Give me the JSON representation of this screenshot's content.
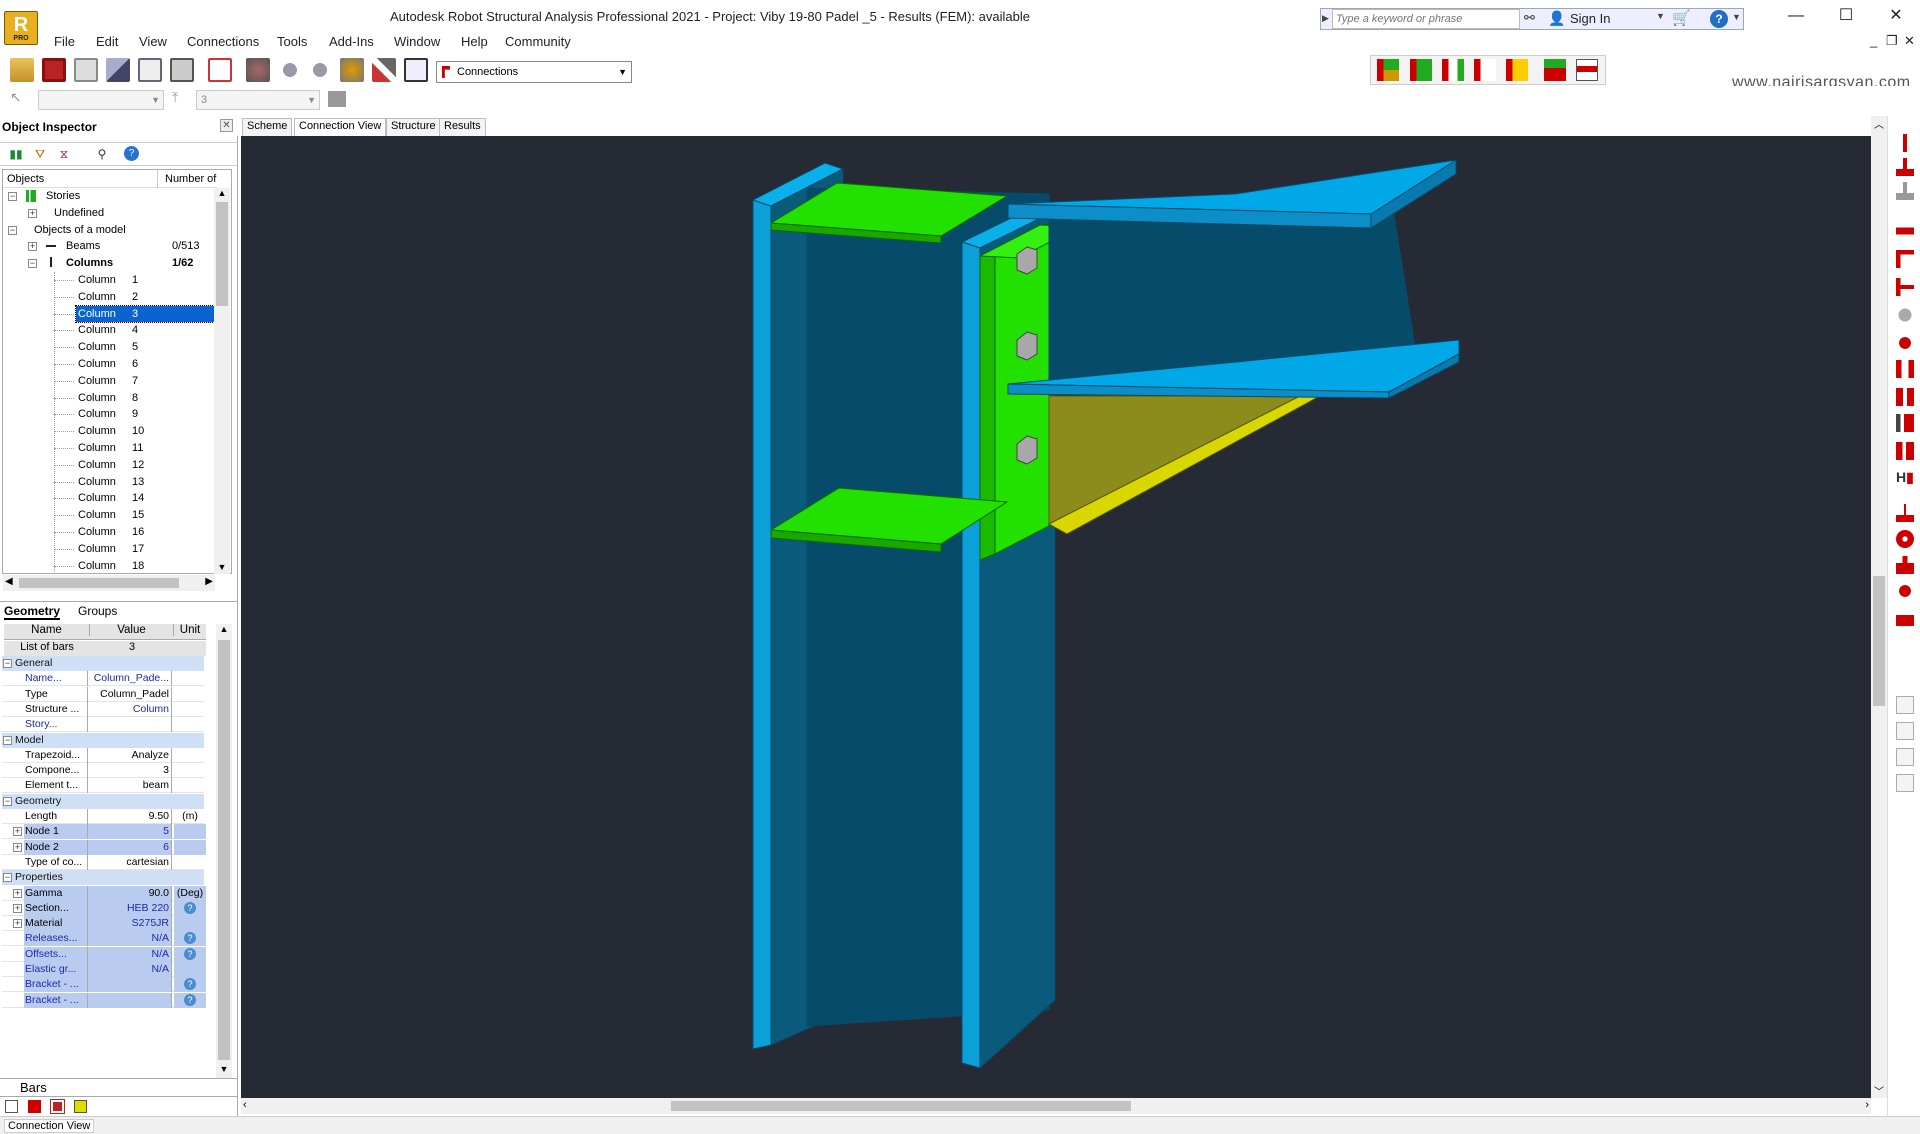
{
  "window": {
    "title": "Autodesk Robot Structural Analysis Professional 2021 - Project: Viby 19-80 Padel _5 - Results (FEM): available",
    "logo_letter": "R",
    "logo_badge": "PRO",
    "search_placeholder": "Type a keyword or phrase",
    "sign_in": "Sign In"
  },
  "menu": [
    "File",
    "Edit",
    "View",
    "Connections",
    "Tools",
    "Add-Ins",
    "Window",
    "Help",
    "Community"
  ],
  "toolbar": {
    "layout_combo": "Connections",
    "disabled_combo2": "3"
  },
  "watermark": "www.nairisargsyan.com",
  "object_inspector": {
    "title": "Object Inspector",
    "col_objects": "Objects",
    "col_number": "Number of o...",
    "tree": {
      "stories": "Stories",
      "undefined": "Undefined",
      "objects_of_model": "Objects of a model",
      "beams": "Beams",
      "beams_count": "0/513",
      "columns": "Columns",
      "columns_count": "1/62",
      "column_items": [
        {
          "name": "Column",
          "num": "1"
        },
        {
          "name": "Column",
          "num": "2"
        },
        {
          "name": "Column",
          "num": "3"
        },
        {
          "name": "Column",
          "num": "4"
        },
        {
          "name": "Column",
          "num": "5"
        },
        {
          "name": "Column",
          "num": "6"
        },
        {
          "name": "Column",
          "num": "7"
        },
        {
          "name": "Column",
          "num": "8"
        },
        {
          "name": "Column",
          "num": "9"
        },
        {
          "name": "Column",
          "num": "10"
        },
        {
          "name": "Column",
          "num": "11"
        },
        {
          "name": "Column",
          "num": "12"
        },
        {
          "name": "Column",
          "num": "13"
        },
        {
          "name": "Column",
          "num": "14"
        },
        {
          "name": "Column",
          "num": "15"
        },
        {
          "name": "Column",
          "num": "16"
        },
        {
          "name": "Column",
          "num": "17"
        },
        {
          "name": "Column",
          "num": "18"
        }
      ],
      "selected_index": 2
    },
    "tabs": [
      "Geometry",
      "Groups"
    ],
    "props_header": {
      "name": "Name",
      "value": "Value",
      "unit": "Unit"
    },
    "list_of_bars": {
      "name": "List of bars",
      "value": "3"
    },
    "sections": [
      {
        "title": "General",
        "rows": [
          {
            "name": "Name...",
            "value": "Column_Pade...",
            "unit": "",
            "blue": true
          },
          {
            "name": "Type",
            "value": "Column_Padel",
            "unit": ""
          },
          {
            "name": "Structure ...",
            "value": "Column",
            "unit": "",
            "blueval": true
          },
          {
            "name": "Story...",
            "value": "",
            "unit": "",
            "blue": true
          }
        ]
      },
      {
        "title": "Model",
        "rows": [
          {
            "name": "Trapezoid...",
            "value": "Analyze",
            "unit": ""
          },
          {
            "name": "Compone...",
            "value": "3",
            "unit": ""
          },
          {
            "name": "Element t...",
            "value": "beam",
            "unit": ""
          }
        ]
      },
      {
        "title": "Geometry",
        "rows": [
          {
            "name": "Length",
            "value": "9.50",
            "unit": "(m)"
          },
          {
            "name": "Node 1",
            "value": "5",
            "unit": "",
            "expand": true,
            "shade": true,
            "blueval": true
          },
          {
            "name": "Node 2",
            "value": "6",
            "unit": "",
            "expand": true,
            "shade": true,
            "blueval": true
          },
          {
            "name": "Type of co...",
            "value": "cartesian",
            "unit": ""
          }
        ]
      },
      {
        "title": "Properties",
        "rows": [
          {
            "name": "Gamma",
            "value": "90.0",
            "unit": "(Deg)",
            "expand": true,
            "shade": true
          },
          {
            "name": "Section...",
            "value": "HEB 220",
            "unit": "?",
            "expand": true,
            "shade": true,
            "blueval": true
          },
          {
            "name": "Material",
            "value": "S275JR",
            "unit": "",
            "expand": true,
            "shade": true,
            "blueval": true
          },
          {
            "name": "Releases...",
            "value": "N/A",
            "unit": "?",
            "shade": true,
            "blue": true
          },
          {
            "name": "Offsets...",
            "value": "N/A",
            "unit": "?",
            "shade": true,
            "blue": true
          },
          {
            "name": "Elastic gr...",
            "value": "N/A",
            "unit": "",
            "shade": true,
            "blue": true
          },
          {
            "name": "Bracket - ...",
            "value": "",
            "unit": "?",
            "shade": true,
            "blue": true
          },
          {
            "name": "Bracket - ...",
            "value": "",
            "unit": "?",
            "shade": true,
            "blue": true
          }
        ]
      }
    ],
    "bottom_tab": "Bars"
  },
  "view_tabs": [
    "Scheme",
    "Connection View",
    "Structure",
    "Results"
  ],
  "active_view_tab": "Connection View",
  "status": "Connection View",
  "colors": {
    "viewport_bg": "#262a35",
    "steel_blue": "#00a8e8",
    "plate_green": "#22e000",
    "gusset_yellow": "#c8c800",
    "selection": "#0a64d0"
  }
}
